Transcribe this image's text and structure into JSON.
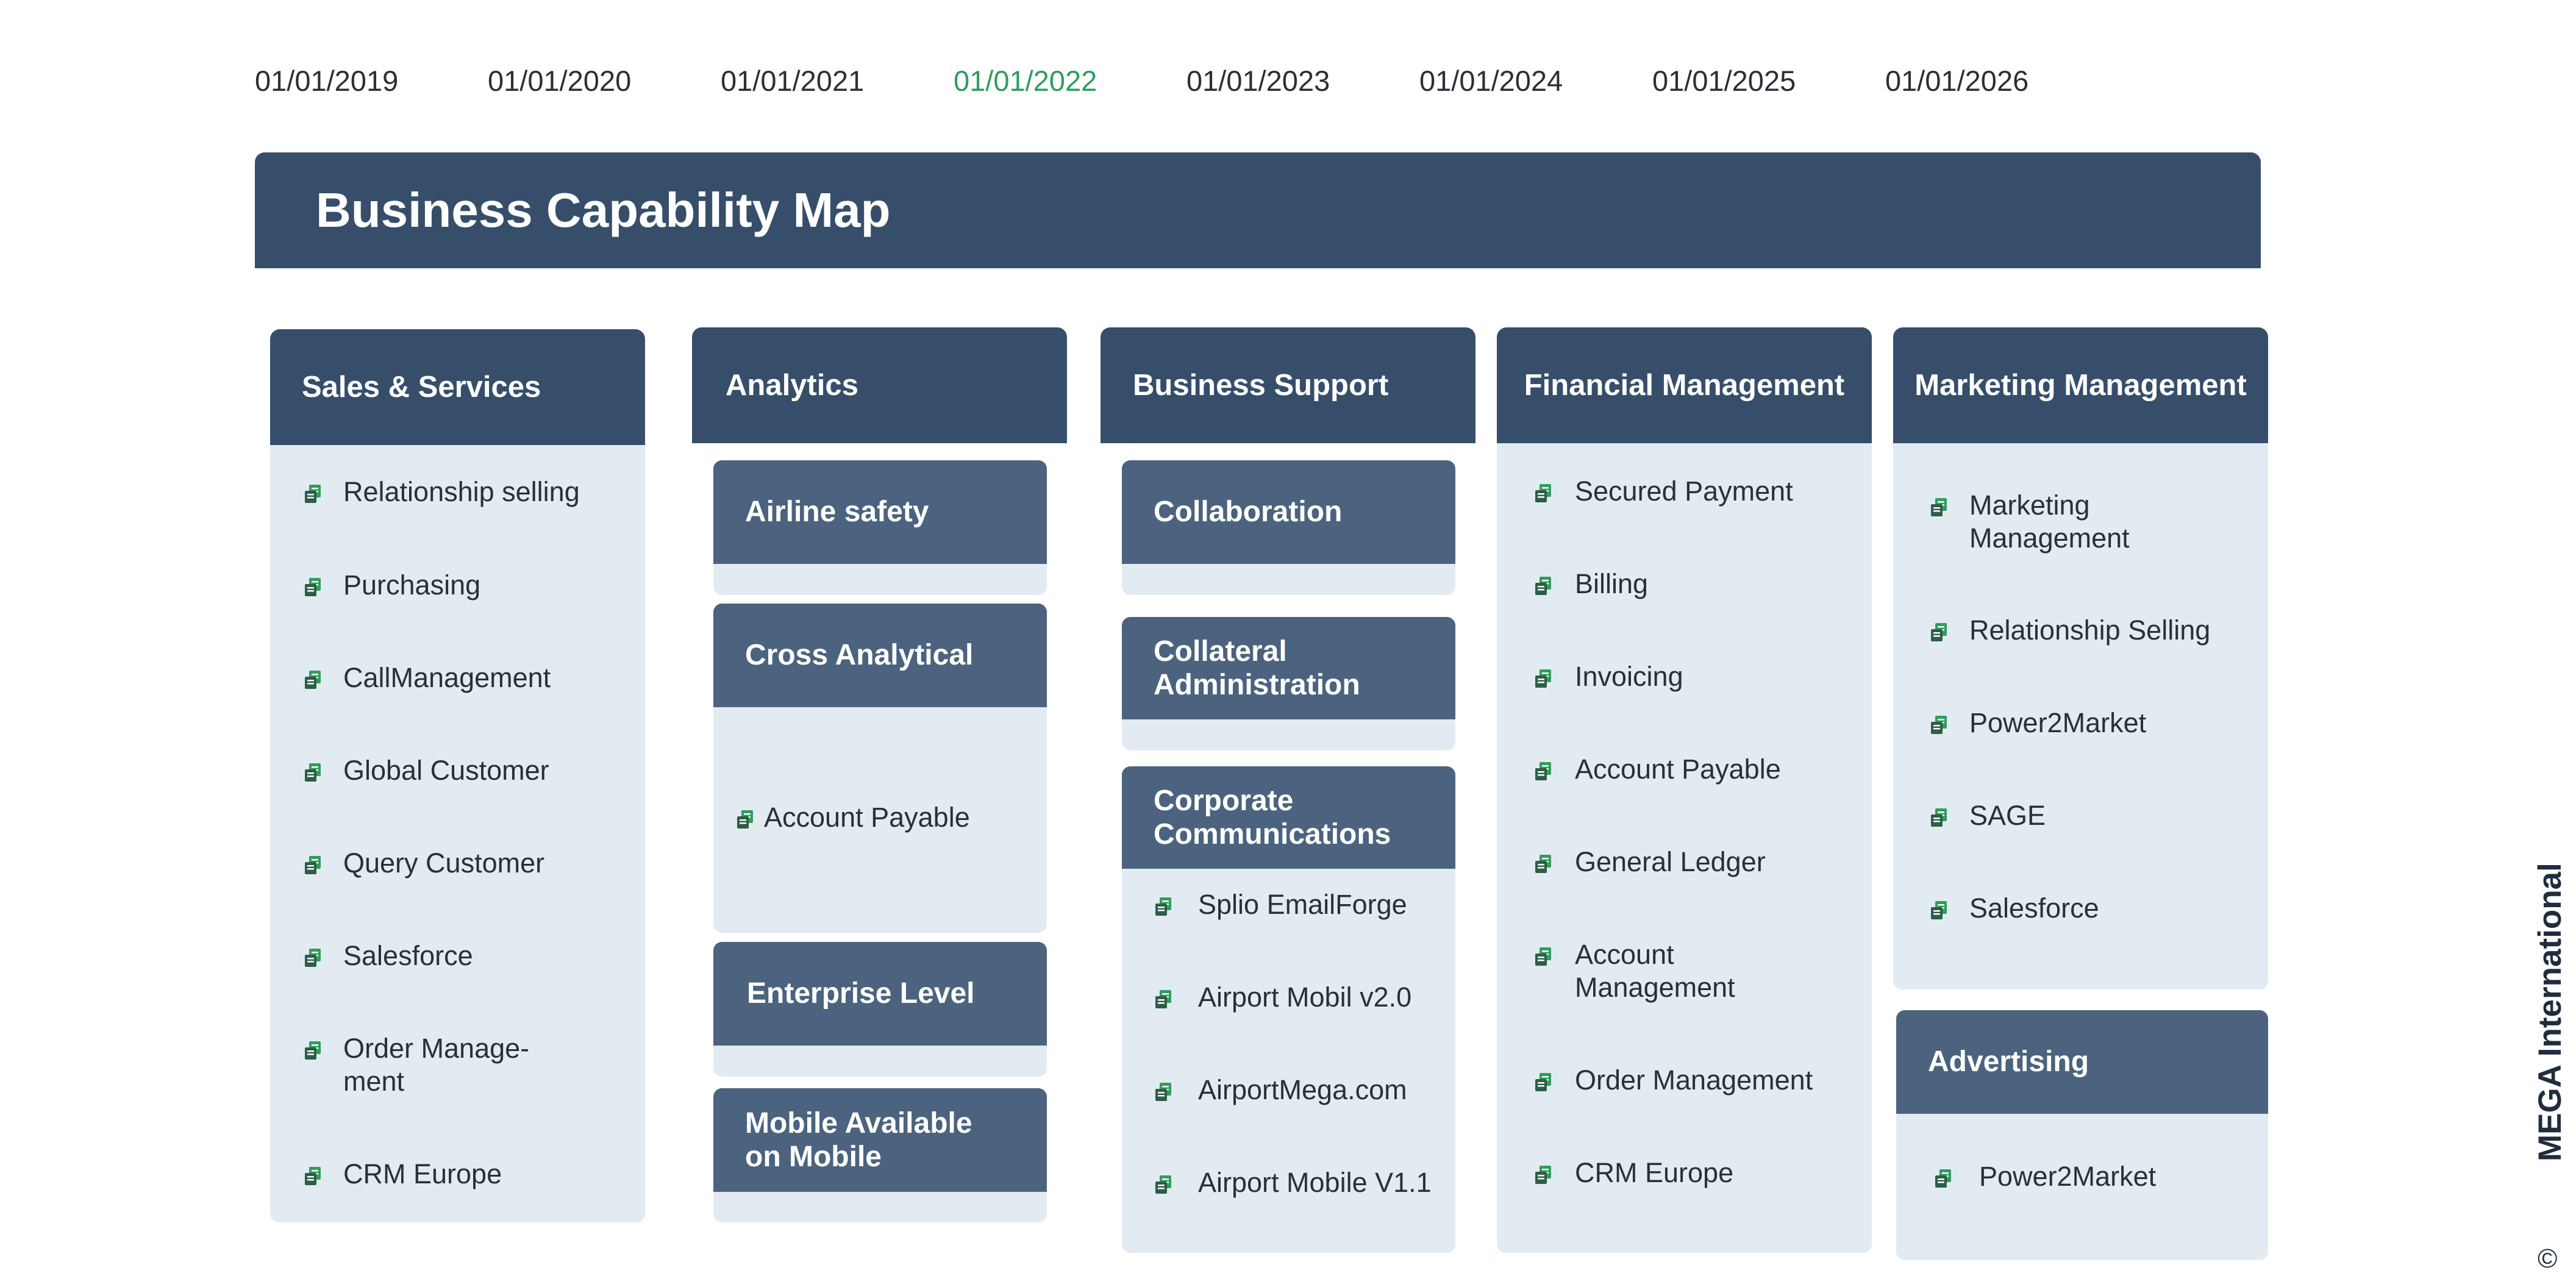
{
  "timeline": {
    "dates": [
      "01/01/2019",
      "01/01/2020",
      "01/01/2021",
      "01/01/2022",
      "01/01/2023",
      "01/01/2024",
      "01/01/2025",
      "01/01/2026"
    ],
    "active_index": 3
  },
  "map": {
    "title": "Business Capability Map",
    "columns": {
      "sales": {
        "title": "Sales & Services",
        "items": [
          "Relationship selling",
          "Purchasing",
          "CallManagement",
          "Global Customer",
          "Query Customer",
          "Salesforce",
          "Order Manage-\nment",
          "CRM Europe"
        ]
      },
      "analytics": {
        "title": "Analytics",
        "subs": {
          "airline_safety": {
            "title": "Airline safety"
          },
          "cross_analytical": {
            "title": "Cross Analytical",
            "items": [
              "Account Payable"
            ]
          },
          "enterprise_level": {
            "title": "Enterprise Level"
          },
          "mobile": {
            "title": "Mobile Available\non Mobile"
          }
        }
      },
      "business_support": {
        "title": "Business Support",
        "subs": {
          "collaboration": {
            "title": "Collaboration"
          },
          "collateral": {
            "title": "Collateral\nAdministration"
          },
          "corporate": {
            "title": "Corporate\nCommunications",
            "items": [
              "Splio EmailForge",
              "Airport Mobil v2.0",
              "AirportMega.com",
              "Airport Mobile V1.1"
            ]
          }
        }
      },
      "financial": {
        "title": "Financial Management",
        "items": [
          "Secured Payment",
          "Billing",
          "Invoicing",
          "Account Payable",
          "General Ledger",
          "Account\nManagement",
          "Order Management",
          "CRM Europe"
        ]
      },
      "marketing": {
        "title": "Marketing Management",
        "items": [
          "Marketing\nManagement",
          "Relationship Selling",
          "Power2Market",
          "SAGE",
          "Salesforce"
        ],
        "advertising": {
          "title": "Advertising",
          "items": [
            "Power2Market"
          ]
        }
      }
    }
  },
  "branding": {
    "vendor": "MEGA International",
    "copyright": "©"
  },
  "colors": {
    "header": "#364e6a",
    "subheader": "#4b637e",
    "panel": "#e2ebf2",
    "active_date": "#2e9e5b",
    "icon_green": "#2e9e5b",
    "icon_dark": "#2f5d46"
  },
  "icons": {
    "application": "application-icon"
  }
}
